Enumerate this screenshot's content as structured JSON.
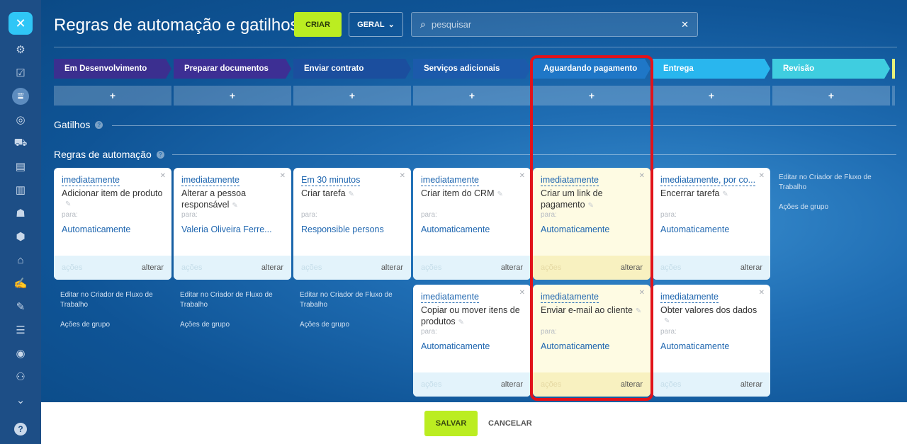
{
  "rail": {
    "close_label": "✕",
    "icons": [
      "activity-icon",
      "tasks-icon",
      "funnel-icon",
      "target-icon",
      "cart-icon",
      "contact-card-icon",
      "chart-icon",
      "robot-icon",
      "box-icon",
      "bank-icon",
      "signature-icon",
      "edit-icon",
      "checklist-icon",
      "circle-icon",
      "team-icon",
      "chevron-down-icon"
    ],
    "help_label": "?"
  },
  "header": {
    "title": "Regras de automação e gatilhos",
    "create_label": "CRIAR",
    "filter_label": "GERAL",
    "search_placeholder": "pesquisar"
  },
  "stages": [
    {
      "label": "Em Desenvolvimento",
      "color": "#3b2f8f"
    },
    {
      "label": "Preparar documentos",
      "color": "#3d2f94"
    },
    {
      "label": "Enviar contrato",
      "color": "#1b4e9e"
    },
    {
      "label": "Serviços adicionais",
      "color": "#1c5aab"
    },
    {
      "label": "Aguardando pagamento",
      "color": "#1f77c7"
    },
    {
      "label": "Entrega",
      "color": "#29b6ee"
    },
    {
      "label": "Revisão",
      "color": "#3fcde0"
    }
  ],
  "stage_add_label": "+",
  "sections": {
    "triggers_label": "Gatilhos",
    "rules_label": "Regras de automação",
    "help": "?"
  },
  "cards": [
    {
      "when": "imediatamente",
      "title": "Adicionar item de produto",
      "para": "para:",
      "target": "Automaticamente",
      "acoes": "ações",
      "alterar": "alterar"
    },
    {
      "when": "imediatamente",
      "title": "Alterar a pessoa responsável",
      "para": "para:",
      "target": "Valeria Oliveira Ferre...",
      "acoes": "ações",
      "alterar": "alterar"
    },
    {
      "when": "Em 30 minutos",
      "title": "Criar tarefa",
      "para": "para:",
      "target": "Responsible persons",
      "acoes": "ações",
      "alterar": "alterar"
    },
    {
      "when": "imediatamente",
      "title": "Criar item do CRM",
      "para": "para:",
      "target": "Automaticamente",
      "acoes": "ações",
      "alterar": "alterar"
    },
    {
      "when": "imediatamente",
      "title": "Criar um link de pagamento",
      "para": "para:",
      "target": "Automaticamente",
      "acoes": "ações",
      "alterar": "alterar"
    },
    {
      "when": "imediatamente, por co...",
      "title": "Encerrar tarefa",
      "para": "para:",
      "target": "Automaticamente",
      "acoes": "ações",
      "alterar": "alterar"
    },
    {
      "when": "imediatamente",
      "title": "Copiar ou mover itens de produtos",
      "para": "para:",
      "target": "Automaticamente",
      "acoes": "ações",
      "alterar": "alterar"
    },
    {
      "when": "imediatamente",
      "title": "Enviar e-mail ao cliente",
      "para": "para:",
      "target": "Automaticamente",
      "acoes": "ações",
      "alterar": "alterar"
    },
    {
      "when": "imediatamente",
      "title": "Obter valores dos dados",
      "para": "para:",
      "target": "Automaticamente",
      "acoes": "ações",
      "alterar": "alterar"
    }
  ],
  "column_links": {
    "edit": "Editar no Criador de Fluxo de Trabalho",
    "group": "Ações de grupo"
  },
  "footer": {
    "save_label": "SALVAR",
    "cancel_label": "CANCELAR"
  }
}
